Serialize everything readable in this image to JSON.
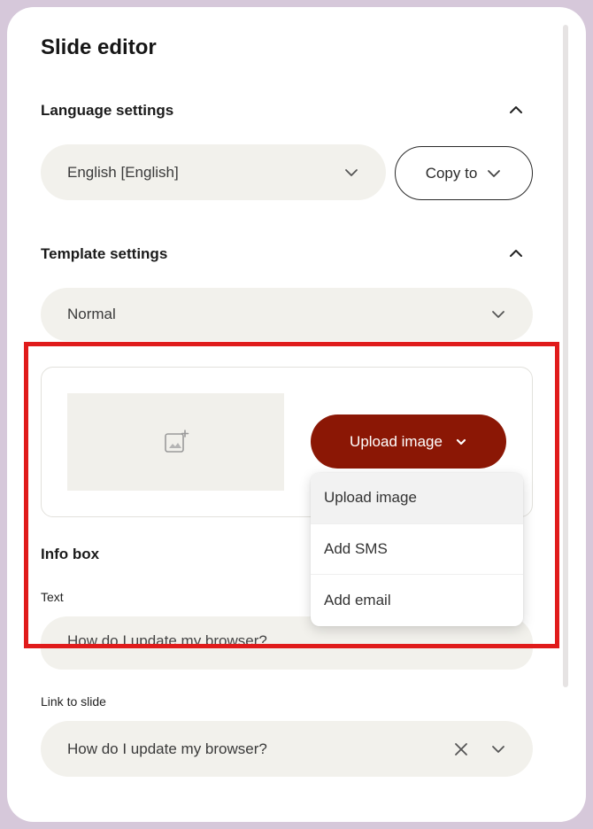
{
  "editor": {
    "title": "Slide editor"
  },
  "language_settings": {
    "heading": "Language settings",
    "selected_language": "English [English]",
    "copy_to_label": "Copy to"
  },
  "template_settings": {
    "heading": "Template settings",
    "selected_template": "Normal"
  },
  "image_upload": {
    "button_label": "Upload image",
    "menu_items": [
      "Upload image",
      "Add SMS",
      "Add email"
    ]
  },
  "info_box": {
    "heading": "Info box",
    "text_label": "Text",
    "text_value": "How do I update my browser?"
  },
  "link_to_slide": {
    "label": "Link to slide",
    "value": "How do I update my browser?"
  },
  "colors": {
    "accent": "#8b1705",
    "highlight": "#e01b1b",
    "field_bg": "#f2f1ec",
    "frame": "#d6c8da"
  },
  "icons": {
    "collapse": "chevron-up-icon",
    "dropdown": "chevron-down-icon",
    "add_image": "add-image-icon",
    "clear": "close-icon"
  }
}
